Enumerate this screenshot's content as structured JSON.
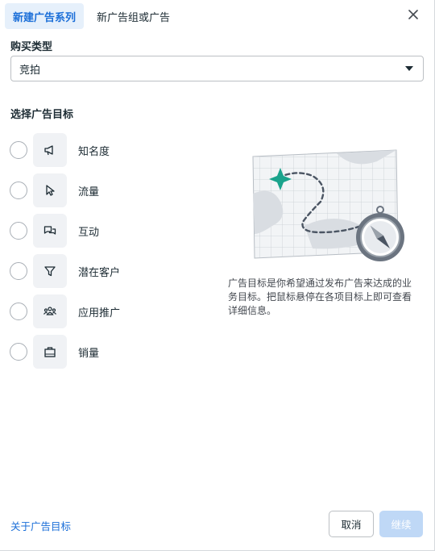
{
  "tabs": [
    {
      "label": "新建广告系列",
      "active": true
    },
    {
      "label": "新广告组或广告",
      "active": false
    }
  ],
  "buy_type": {
    "label": "购买类型",
    "selected": "竞拍"
  },
  "objectives": {
    "label": "选择广告目标",
    "items": [
      {
        "label": "知名度",
        "icon": "megaphone-icon"
      },
      {
        "label": "流量",
        "icon": "cursor-icon"
      },
      {
        "label": "互动",
        "icon": "chat-bubbles-icon"
      },
      {
        "label": "潜在客户",
        "icon": "filter-icon"
      },
      {
        "label": "应用推广",
        "icon": "people-icon"
      },
      {
        "label": "销量",
        "icon": "shopping-bag-icon"
      }
    ]
  },
  "description": "广告目标是你希望通过发布广告来达成的业务目标。把鼠标悬停在各项目标上即可查看详细信息。",
  "footer": {
    "about_link": "关于广告目标",
    "cancel_label": "取消",
    "continue_label": "继续"
  },
  "colors": {
    "accent": "#1a6ed8",
    "tab_active_bg": "#e6f0fb",
    "continue_disabled": "#bfd8f6",
    "map_star": "#1aa38c"
  }
}
